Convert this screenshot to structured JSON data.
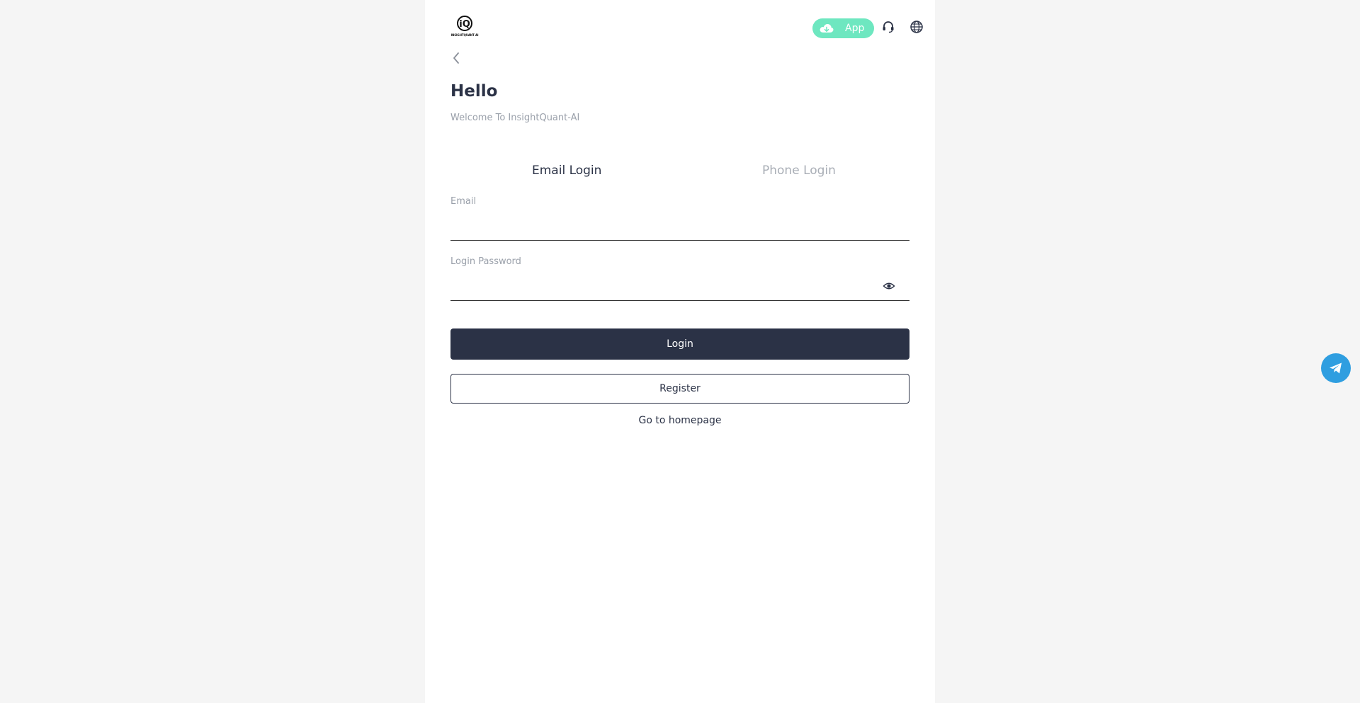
{
  "header": {
    "logo_text": "INSIGHTQUANT AI",
    "logo_icon": "iq-logo",
    "app_label": "App",
    "app_icon": "cloud-download-icon",
    "support_icon": "headset-icon",
    "language_icon": "globe-icon",
    "accent_color": "#6ee7c0"
  },
  "nav": {
    "back_icon": "chevron-left-icon"
  },
  "intro": {
    "title": "Hello",
    "subtitle": "Welcome To InsightQuant-AI"
  },
  "tabs": [
    {
      "label": "Email Login",
      "active": true
    },
    {
      "label": "Phone Login",
      "active": false
    }
  ],
  "form": {
    "email_label": "Email",
    "email_value": "",
    "password_label": "Login Password",
    "password_value": "",
    "password_toggle_icon": "eye-icon"
  },
  "actions": {
    "login_label": "Login",
    "register_label": "Register",
    "homepage_label": "Go to homepage",
    "primary_color": "#2b3246"
  },
  "floating": {
    "telegram_icon": "telegram-icon",
    "telegram_color": "#2f9ee0"
  }
}
